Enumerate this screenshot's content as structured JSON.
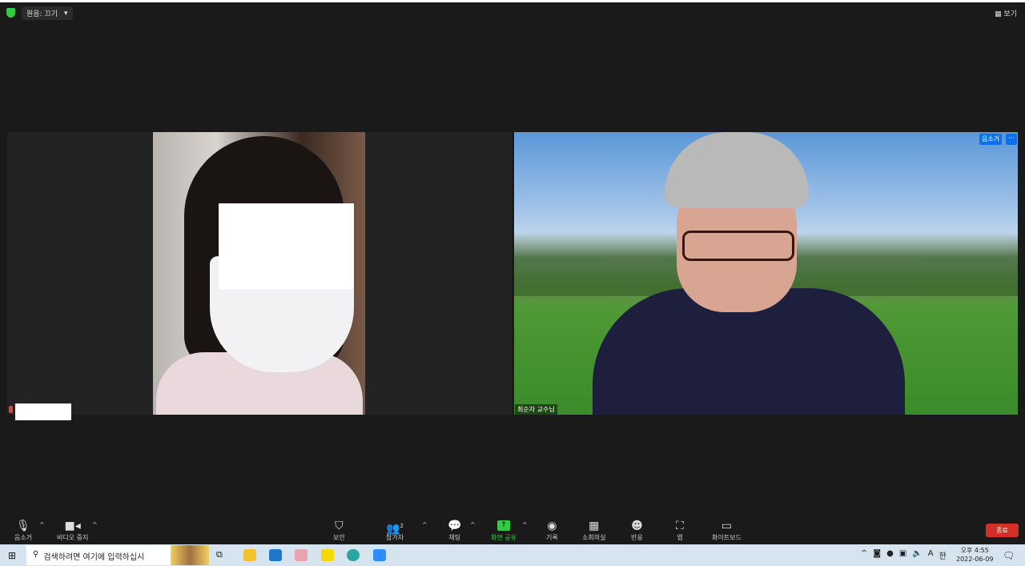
{
  "topbar": {
    "audio_label": "원음: 끄기",
    "dropdown": "▾",
    "view_label": "▦ 보기"
  },
  "tiles": [
    {
      "name": "",
      "muted": true
    },
    {
      "name": "최순자 교수님",
      "mute_badge": "음소거",
      "more": "···"
    }
  ],
  "toolbar": {
    "mute": "음소거",
    "video": "비디오 중지",
    "security": "보안",
    "participants": "참가자",
    "participant_count": "2",
    "chat": "채팅",
    "share": "화면 공유",
    "record": "기록",
    "breakout": "소회의실",
    "reactions": "반응",
    "apps": "앱",
    "whiteboard": "화이트보드",
    "end": "종료",
    "share_color": "#2ecc40",
    "end_color": "#d22f27"
  },
  "taskbar": {
    "search_placeholder": "검색하려면 여기에 입력하십시",
    "time": "오후 4:55",
    "date": "2022-06-09",
    "ime": "A",
    "lang": "한"
  }
}
